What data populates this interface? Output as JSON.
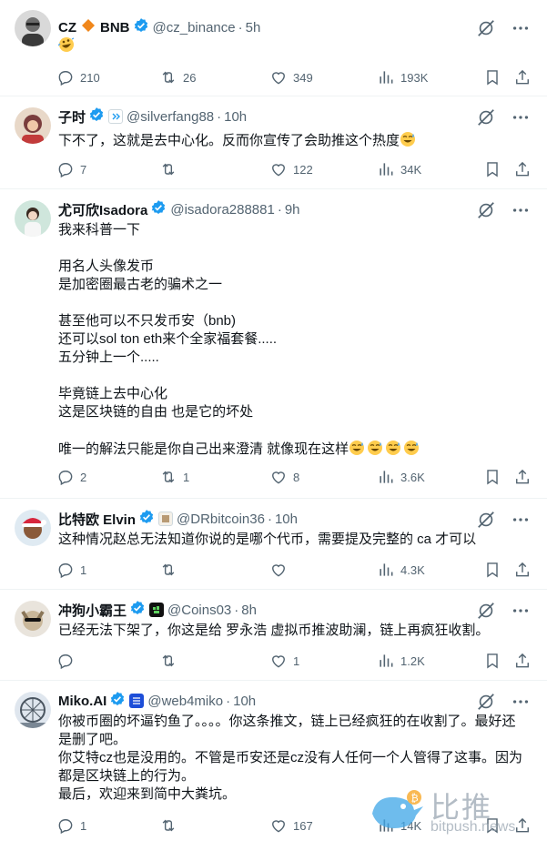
{
  "tweets": [
    {
      "name": "CZ",
      "name_suffix": "BNB",
      "handle": "@cz_binance",
      "time": "5h",
      "text": "",
      "emoji_line": "rofl-emoji",
      "replies": "210",
      "retweets": "26",
      "likes": "349",
      "views": "193K"
    },
    {
      "name": "子时",
      "handle": "@silverfang88",
      "time": "10h",
      "text": "下不了，这就是去中心化。反而你宣传了会助推这个热度",
      "replies": "7",
      "retweets": "",
      "likes": "122",
      "views": "34K"
    },
    {
      "name": "尤可欣Isadora",
      "handle": "@isadora288881",
      "time": "9h",
      "text": "我来科普一下\n\n用名人头像发币\n是加密圈最古老的骗术之一\n\n甚至他可以不只发币安（bnb)\n还可以sol ton eth来个全家福套餐.....\n五分钟上一个.....\n\n毕竟链上去中心化\n这是区块链的自由 也是它的坏处\n\n唯一的解法只能是你自己出来澄清 就像现在这样",
      "replies": "2",
      "retweets": "1",
      "likes": "8",
      "views": "3.6K"
    },
    {
      "name": "比特欧 Elvin",
      "handle": "@DRbitcoin36",
      "time": "10h",
      "text": "这种情况赵总无法知道你说的是哪个代币，需要提及完整的 ca 才可以",
      "replies": "1",
      "retweets": "",
      "likes": "",
      "views": "4.3K"
    },
    {
      "name": "冲狗小霸王",
      "handle": "@Coins03",
      "time": "8h",
      "text": "已经无法下架了，你这是给 罗永浩 虚拟币推波助澜，链上再疯狂收割。",
      "replies": "",
      "retweets": "",
      "likes": "1",
      "views": "1.2K"
    },
    {
      "name": "Miko.AI",
      "handle": "@web4miko",
      "time": "10h",
      "text": "你被币圈的坏逼钓鱼了。。。。你这条推文，链上已经疯狂的在收割了。最好还是删了吧。\n你艾特cz也是没用的。不管是币安还是cz没有人任何一个人管得了这事。因为都是区块链上的行为。\n最后，欢迎来到简中大粪坑。",
      "replies": "1",
      "retweets": "",
      "likes": "167",
      "views": "14K"
    }
  ],
  "watermark": {
    "cn": "比推",
    "en": "bitpush.news"
  },
  "colors": {
    "verified": "#1d9bf0",
    "muted": "#536471",
    "text": "#0f1419",
    "divider": "#eff3f4",
    "bnb": "#f3ba2f"
  }
}
